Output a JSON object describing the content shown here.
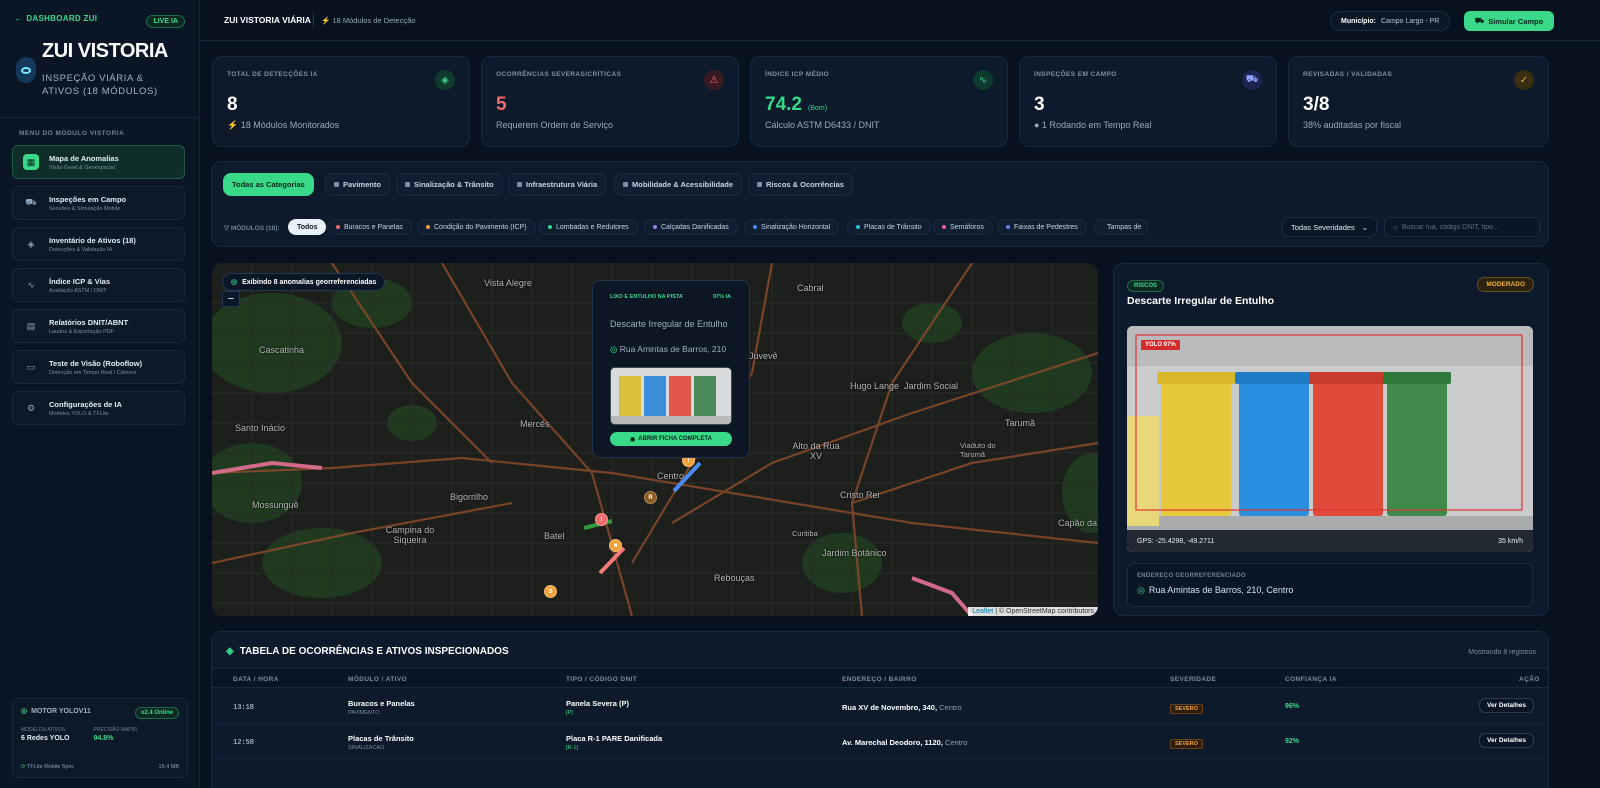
{
  "sidebar": {
    "back_label": "DASHBOARD ZUI",
    "live_badge": "LIVE IA",
    "brand_title": "ZUI VISTORIA",
    "brand_subtitle": "INSPEÇÃO VIÁRIA & ATIVOS (18 MÓDULOS)",
    "menu_label": "MENU DO MÓDULO VISTORIA",
    "items": [
      {
        "title": "Mapa de Anomalias",
        "sub": "Visão Geral & Geoespacial",
        "icon": "map-icon"
      },
      {
        "title": "Inspeções em Campo",
        "sub": "Sessões & Simulação Mobile",
        "icon": "car-icon"
      },
      {
        "title": "Inventário de Ativos (18)",
        "sub": "Detecções & Validação IA",
        "icon": "layers-icon"
      },
      {
        "title": "Índice ICP & Vias",
        "sub": "Avaliação ASTM / DNIT",
        "icon": "activity-icon"
      },
      {
        "title": "Relatórios DNIT/ABNT",
        "sub": "Laudos & Exportação PDF",
        "icon": "document-icon"
      },
      {
        "title": "Teste de Visão (Roboflow)",
        "sub": "Detecção em Tempo Real / Câmera",
        "icon": "camera-icon"
      },
      {
        "title": "Configurações de IA",
        "sub": "Modelos YOLO & TFLite",
        "icon": "gear-icon"
      }
    ],
    "engine": {
      "title": "MOTOR YOLOV11",
      "badge": "v2.4 Online",
      "models_k": "MODELOS ATIVOS",
      "models_v": "6 Redes YOLO",
      "precision_k": "PRECISÃO MAP50",
      "precision_v": "94.8%",
      "footer_left": "TFLite Mobile Sync",
      "footer_right": "15.4 MB"
    }
  },
  "header": {
    "title": "ZUI VISTORIA VIÁRIA",
    "subtitle": "18 Módulos de Detecção",
    "municipio_label": "Município:",
    "municipio_value": "Campo Largo - PR",
    "simular_label": "Simular Campo"
  },
  "kpis": [
    {
      "label": "TOTAL DE DETECÇÕES IA",
      "value": "8",
      "unit": "",
      "note": "18 Módulos Monitorados",
      "icon": "layers-icon",
      "color": "#39d98a",
      "bg": "#0f3a2e"
    },
    {
      "label": "OCORRÊNCIAS SEVERAS/CRÍTICAS",
      "value": "5",
      "unit": "",
      "note": "Requerem Ordem de Serviço",
      "icon": "alert-icon",
      "color": "#f26b6b",
      "bg": "#3a1a22"
    },
    {
      "label": "ÍNDICE ICP MÉDIO",
      "value": "74.2",
      "unit": "(Bom)",
      "note": "Cálculo ASTM D6433 / DNIT",
      "icon": "activity-icon",
      "color": "#39d98a",
      "bg": "#0f3a2e"
    },
    {
      "label": "INSPEÇÕES EM CAMPO",
      "value": "3",
      "unit": "",
      "note": "● 1 Rodando em Tempo Real",
      "icon": "car-icon",
      "color": "#8fa6ff",
      "bg": "#1d2450"
    },
    {
      "label": "REVISADAS / VALIDADAS",
      "value": "3/8",
      "unit": "",
      "note": "38% auditadas por fiscal",
      "icon": "check-circle-icon",
      "color": "#f2b134",
      "bg": "#3a2e10"
    }
  ],
  "categories": [
    "Todas as Categorias",
    "Pavimento",
    "Sinalização & Trânsito",
    "Infraestrutura Viária",
    "Mobilidade & Acessibilidade",
    "Riscos & Ocorrências"
  ],
  "modules_label": "MÓDULOS (18):",
  "modules": [
    {
      "label": "Todos",
      "color": ""
    },
    {
      "label": "Buracos e Panelas",
      "color": "#f26b6b"
    },
    {
      "label": "Condição do Pavimento (ICP)",
      "color": "#f2a23c"
    },
    {
      "label": "Lombadas e Redutores",
      "color": "#39d98a"
    },
    {
      "label": "Calçadas Danificadas",
      "color": "#a37cf2"
    },
    {
      "label": "Sinalização Horizontal",
      "color": "#4b8cf2"
    },
    {
      "label": "Placas de Trânsito",
      "color": "#2cc4d6"
    },
    {
      "label": "Semáforos",
      "color": "#f25cb0"
    },
    {
      "label": "Faixas de Pedestres",
      "color": "#6b7cf2"
    },
    {
      "label": "Tampas de",
      "color": "#f26b6b"
    }
  ],
  "severity_select": "Todas Severidades",
  "search_placeholder": "Buscar rua, código DNIT, tipo...",
  "map": {
    "badge": "Exibindo 8 anomalias georreferenciadas",
    "zoom_out": "−",
    "labels": [
      "Vista Alegre",
      "Cabral",
      "Cascatinha",
      "Juvevê",
      "Hugo Lange",
      "Jardim Social",
      "Santo Inácio",
      "Mercês",
      "Alto da Rua XV",
      "Tarumã",
      "Viaduto do Tarumã",
      "Centro",
      "Bigorrilho",
      "Cristo Rei",
      "Mossunguê",
      "Campina do Siqueira",
      "Batel",
      "Jardim Botânico",
      "Capão da",
      "Rebouças",
      "Curitiba"
    ],
    "attribution_leaflet": "Leaflet",
    "attribution_rest": "| © OpenStreetMap contributors",
    "markers": [
      "!",
      "R",
      "!",
      "■",
      "S"
    ],
    "popup": {
      "tag": "LIXO E ENTULHO NA PISTA",
      "confidence": "97% IA",
      "title": "Descarte Irregular de Entulho",
      "address": "Rua Amintas de Barros, 210",
      "button": "ABRIR FICHA COMPLETA"
    }
  },
  "detail": {
    "category": "RISCOS",
    "severity": "MODERADO",
    "title": "Descarte Irregular de Entulho",
    "yolo": "YOLO 97%",
    "gps": "GPS: -25.4298, -49.2711",
    "speed": "35 km/h",
    "address_label": "ENDEREÇO GEORREFERENCIADO",
    "address": "Rua Amintas de Barros, 210, Centro"
  },
  "table": {
    "title": "TABELA DE OCORRÊNCIAS E ATIVOS INSPECIONADOS",
    "count": "Mostrando 8 registros",
    "headers": [
      "DATA / HORA",
      "MÓDULO / ATIVO",
      "TIPO / CÓDIGO DNIT",
      "ENDEREÇO / BAIRRO",
      "SEVERIDADE",
      "CONFIANÇA IA",
      "AÇÃO"
    ],
    "rows": [
      {
        "time": "13:18",
        "module": "Buracos e Panelas",
        "module_sub": "PAVIMENTO",
        "type": "Panela Severa (P)",
        "code": "[P]",
        "address": "Rua XV de Novembro, 340,",
        "bairro": "Centro",
        "severity": "SEVERO",
        "confidence": "96%",
        "action": "Ver Detalhes"
      },
      {
        "time": "12:58",
        "module": "Placas de Trânsito",
        "module_sub": "SINALIZACAO",
        "type": "Placa R-1 PARE Danificada",
        "code": "[R-1]",
        "address": "Av. Marechal Deodoro, 1120,",
        "bairro": "Centro",
        "severity": "SEVERO",
        "confidence": "92%",
        "action": "Ver Detalhes"
      }
    ]
  }
}
